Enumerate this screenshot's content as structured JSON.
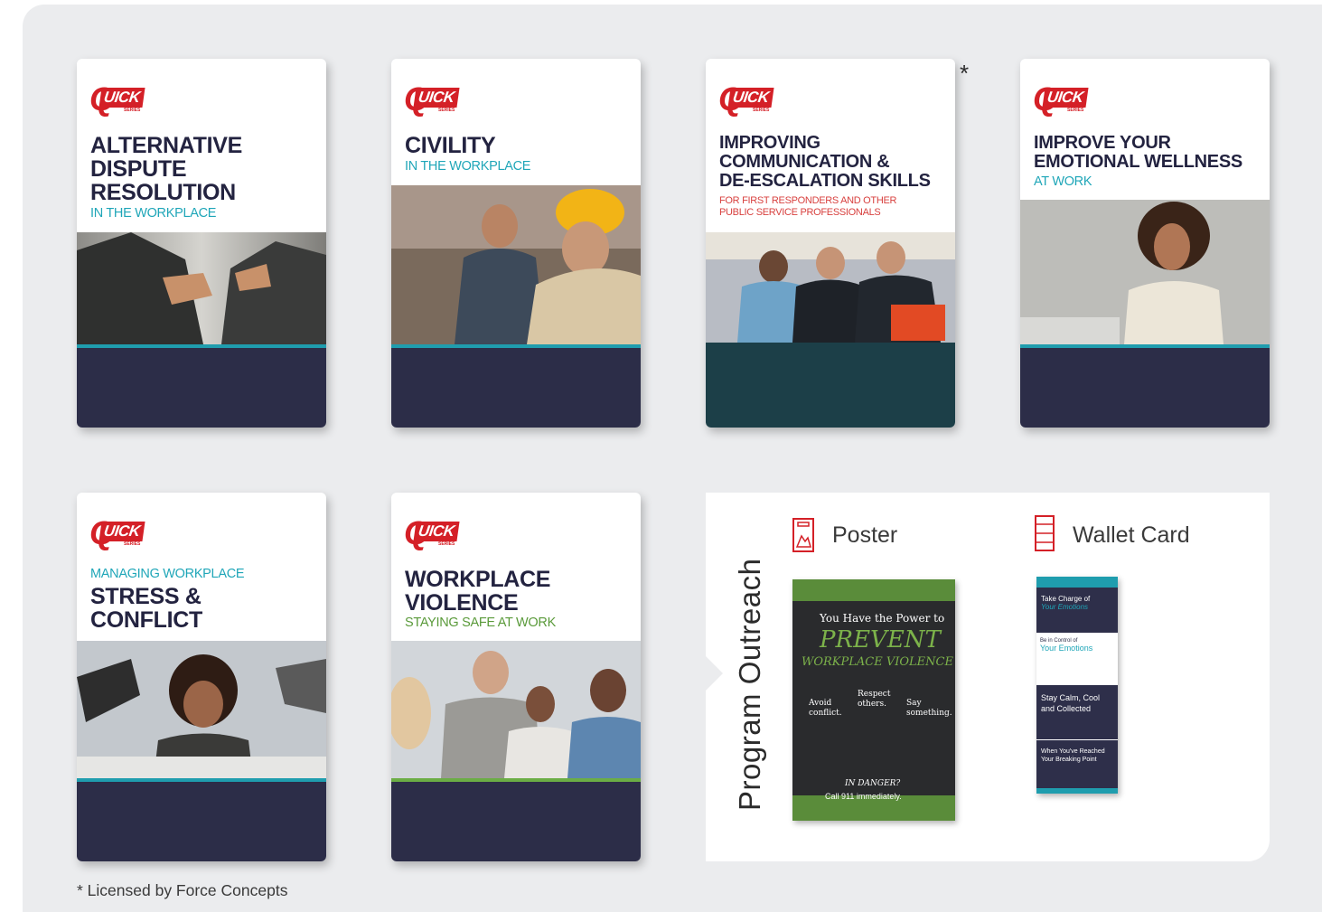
{
  "cards": [
    {
      "title_lines": [
        "ALTERNATIVE",
        "DISPUTE",
        "RESOLUTION"
      ],
      "subtitle": "IN THE WORKPLACE"
    },
    {
      "title_lines": [
        "CIVILITY"
      ],
      "subtitle": "IN THE WORKPLACE"
    },
    {
      "title_lines": [
        "IMPROVING",
        "COMMUNICATION &",
        "DE-ESCALATION SKILLS"
      ],
      "subtitle_lines": [
        "FOR FIRST RESPONDERS AND OTHER",
        "PUBLIC SERVICE PROFESSIONALS"
      ]
    },
    {
      "title_lines": [
        "IMPROVE YOUR",
        "EMOTIONAL WELLNESS"
      ],
      "subtitle": "AT WORK"
    },
    {
      "pre_title": "MANAGING WORKPLACE",
      "title_lines": [
        "STRESS &",
        "CONFLICT"
      ]
    },
    {
      "title_lines": [
        "WORKPLACE",
        "VIOLENCE"
      ],
      "subtitle": "STAYING SAFE AT WORK"
    }
  ],
  "logo": {
    "text": "UICK",
    "q": "Q",
    "sub": "SERIES"
  },
  "asterisk": "*",
  "outreach": {
    "title": "Program Outreach",
    "poster_label": "Poster",
    "wallet_label": "Wallet Card",
    "poster": {
      "line1": "You Have the Power to",
      "line2": "PREVENT",
      "line3": "WORKPLACE VIOLENCE",
      "cols": [
        "Avoid conflict.",
        "Respect others.",
        "Say something."
      ],
      "danger": "IN DANGER?",
      "call": "Call 911 immediately."
    },
    "wallet": {
      "s1": "Take Charge of",
      "s1b": "Your Emotions",
      "s2": "Be in Control of",
      "s2b": "Your Emotions",
      "s3": "Stay Calm, Cool and Collected",
      "s4": "When You've Reached Your Breaking Point"
    }
  },
  "footnote": "* Licensed by Force Concepts",
  "colors": {
    "brand_red": "#d42027",
    "navy": "#2c2d48",
    "teal": "#1f9dae",
    "green": "#6bad45",
    "panel_bg": "#ebecee"
  }
}
